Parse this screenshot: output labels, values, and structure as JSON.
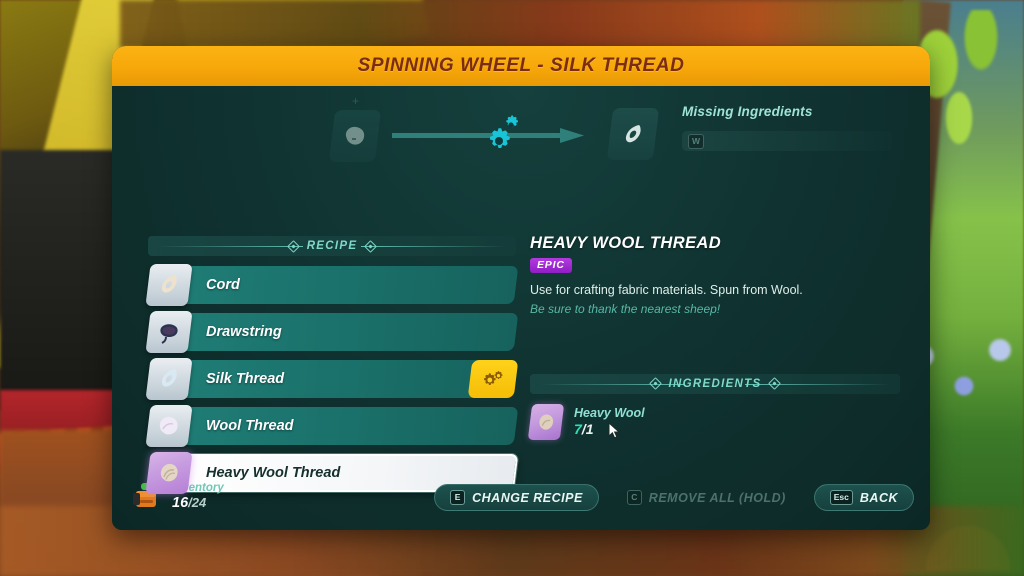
{
  "window": {
    "title": "SPINNING WHEEL - SILK THREAD"
  },
  "craft_preview": {
    "input_slot_icon": "wool-icon",
    "arrow_icon": "arrow-right-icon",
    "gears_icon": "gears-icon",
    "output_slot_icon": "thread-loop-icon",
    "plus_hint": "+"
  },
  "missing": {
    "title": "Missing Ingredients",
    "key": "W"
  },
  "recipe_section": {
    "header": "RECIPE",
    "items": [
      {
        "label": "Cord",
        "icon": "cord-icon",
        "selected": false,
        "crafting": false
      },
      {
        "label": "Drawstring",
        "icon": "drawstring-icon",
        "selected": false,
        "crafting": false
      },
      {
        "label": "Silk Thread",
        "icon": "silk-thread-icon",
        "selected": false,
        "crafting": true
      },
      {
        "label": "Wool Thread",
        "icon": "wool-thread-icon",
        "selected": false,
        "crafting": false
      },
      {
        "label": "Heavy Wool Thread",
        "icon": "heavy-wool-icon",
        "selected": true,
        "crafting": false
      }
    ]
  },
  "detail": {
    "title": "HEAVY WOOL THREAD",
    "rarity": "EPIC",
    "rarity_color": "#a82fd6",
    "description": "Use for crafting fabric materials. Spun from Wool.",
    "flavor": "Be sure to thank the nearest sheep!"
  },
  "ingredients_section": {
    "header": "INGREDIENTS",
    "items": [
      {
        "name": "Heavy Wool",
        "icon": "heavy-wool-icon",
        "have": "7",
        "separator": "/",
        "need": "1"
      }
    ]
  },
  "footer": {
    "inventory": {
      "label": "Inventory",
      "icon": "backpack-icon",
      "current": "16",
      "separator": "/",
      "max": "24"
    },
    "actions": [
      {
        "key": "E",
        "label": "CHANGE RECIPE",
        "disabled": false
      },
      {
        "key": "C",
        "label": "REMOVE ALL (HOLD)",
        "disabled": true
      },
      {
        "key": "Esc",
        "label": "BACK",
        "disabled": false
      }
    ]
  },
  "theme": {
    "header_orange": "#f7a709",
    "header_text": "#7a2d12",
    "panel_dark": "#0f312f",
    "accent_teal": "#7fd9ca",
    "row_teal": "#1a6f69",
    "gear_yellow": "#ffd21a",
    "epic_purple": "#a82fd6",
    "have_green": "#2fe0b4"
  }
}
